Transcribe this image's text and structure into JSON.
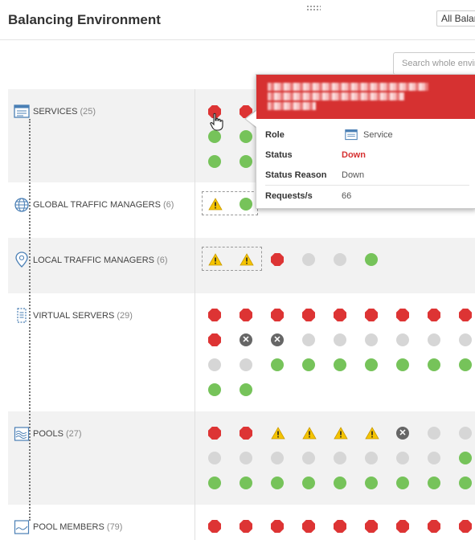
{
  "header": {
    "title": "Balancing Environment",
    "environment_select": "All Balancing Environments"
  },
  "search": {
    "placeholder": "Search whole environment"
  },
  "rows": [
    {
      "key": "services",
      "label": "SERVICES",
      "count": "(25)",
      "icon": "service-icon"
    },
    {
      "key": "gtm",
      "label": "GLOBAL TRAFFIC MANAGERS",
      "count": "(6)",
      "icon": "globe-icon"
    },
    {
      "key": "ltm",
      "label": "LOCAL TRAFFIC MANAGERS",
      "count": "(6)",
      "icon": "location-pin-icon"
    },
    {
      "key": "vs",
      "label": "VIRTUAL SERVERS",
      "count": "(29)",
      "icon": "virtual-server-icon"
    },
    {
      "key": "pools",
      "label": "POOLS",
      "count": "(27)",
      "icon": "pool-icon"
    },
    {
      "key": "members",
      "label": "POOL MEMBERS",
      "count": "(79)",
      "icon": "pool-member-icon"
    }
  ],
  "status_grid": {
    "services": [
      [
        "red",
        "red"
      ],
      [
        "green",
        "green"
      ],
      [
        "green",
        "green"
      ]
    ],
    "gtm": [
      [
        "warn",
        "green"
      ]
    ],
    "ltm": [
      [
        "warn",
        "warn",
        "red",
        "gray",
        "gray",
        "green"
      ]
    ],
    "vs": [
      [
        "red",
        "red",
        "red",
        "red",
        "red",
        "red",
        "red",
        "red",
        "red"
      ],
      [
        "red",
        "err",
        "err",
        "gray",
        "gray",
        "gray",
        "gray",
        "gray",
        "gray"
      ],
      [
        "gray",
        "gray",
        "green",
        "green",
        "green",
        "green",
        "green",
        "green",
        "green"
      ],
      [
        "green",
        "green"
      ]
    ],
    "pools": [
      [
        "red",
        "red",
        "warn",
        "warn",
        "warn",
        "warn",
        "err",
        "gray",
        "gray"
      ],
      [
        "gray",
        "gray",
        "gray",
        "gray",
        "gray",
        "gray",
        "gray",
        "gray",
        "green"
      ],
      [
        "green",
        "green",
        "green",
        "green",
        "green",
        "green",
        "green",
        "green",
        "green"
      ]
    ],
    "members": [
      [
        "red",
        "red",
        "red",
        "red",
        "red",
        "red",
        "red",
        "red",
        "red"
      ]
    ]
  },
  "tooltip": {
    "name_redacted": true,
    "fields": [
      {
        "key": "Role",
        "value": "Service",
        "icon": "service-icon"
      },
      {
        "key": "Status",
        "value": "Down",
        "color": "#d63131"
      },
      {
        "key": "Status Reason",
        "value": "Down"
      },
      {
        "key": "Requests/s",
        "value": "66"
      }
    ]
  },
  "colors": {
    "down": "#dd3434",
    "up": "#76c35a",
    "unknown": "#d6d6d6",
    "error": "#666666",
    "warning": "#f5c400",
    "tooltip_header": "#d63131"
  }
}
